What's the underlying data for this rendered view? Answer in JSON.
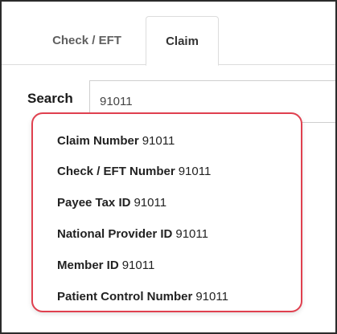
{
  "tabs": [
    {
      "label": "Check / EFT"
    },
    {
      "label": "Claim"
    }
  ],
  "search": {
    "label": "Search",
    "value": "91011"
  },
  "dropdown": {
    "items": [
      {
        "field": "Claim Number",
        "value": "91011"
      },
      {
        "field": "Check / EFT Number",
        "value": "91011"
      },
      {
        "field": "Payee Tax ID",
        "value": "91011"
      },
      {
        "field": "National Provider ID",
        "value": "91011"
      },
      {
        "field": "Member ID",
        "value": "91011"
      },
      {
        "field": "Patient Control Number",
        "value": "91011"
      }
    ]
  },
  "colors": {
    "highlight_border": "#e0404f",
    "frame_border": "#2b2b2b"
  }
}
